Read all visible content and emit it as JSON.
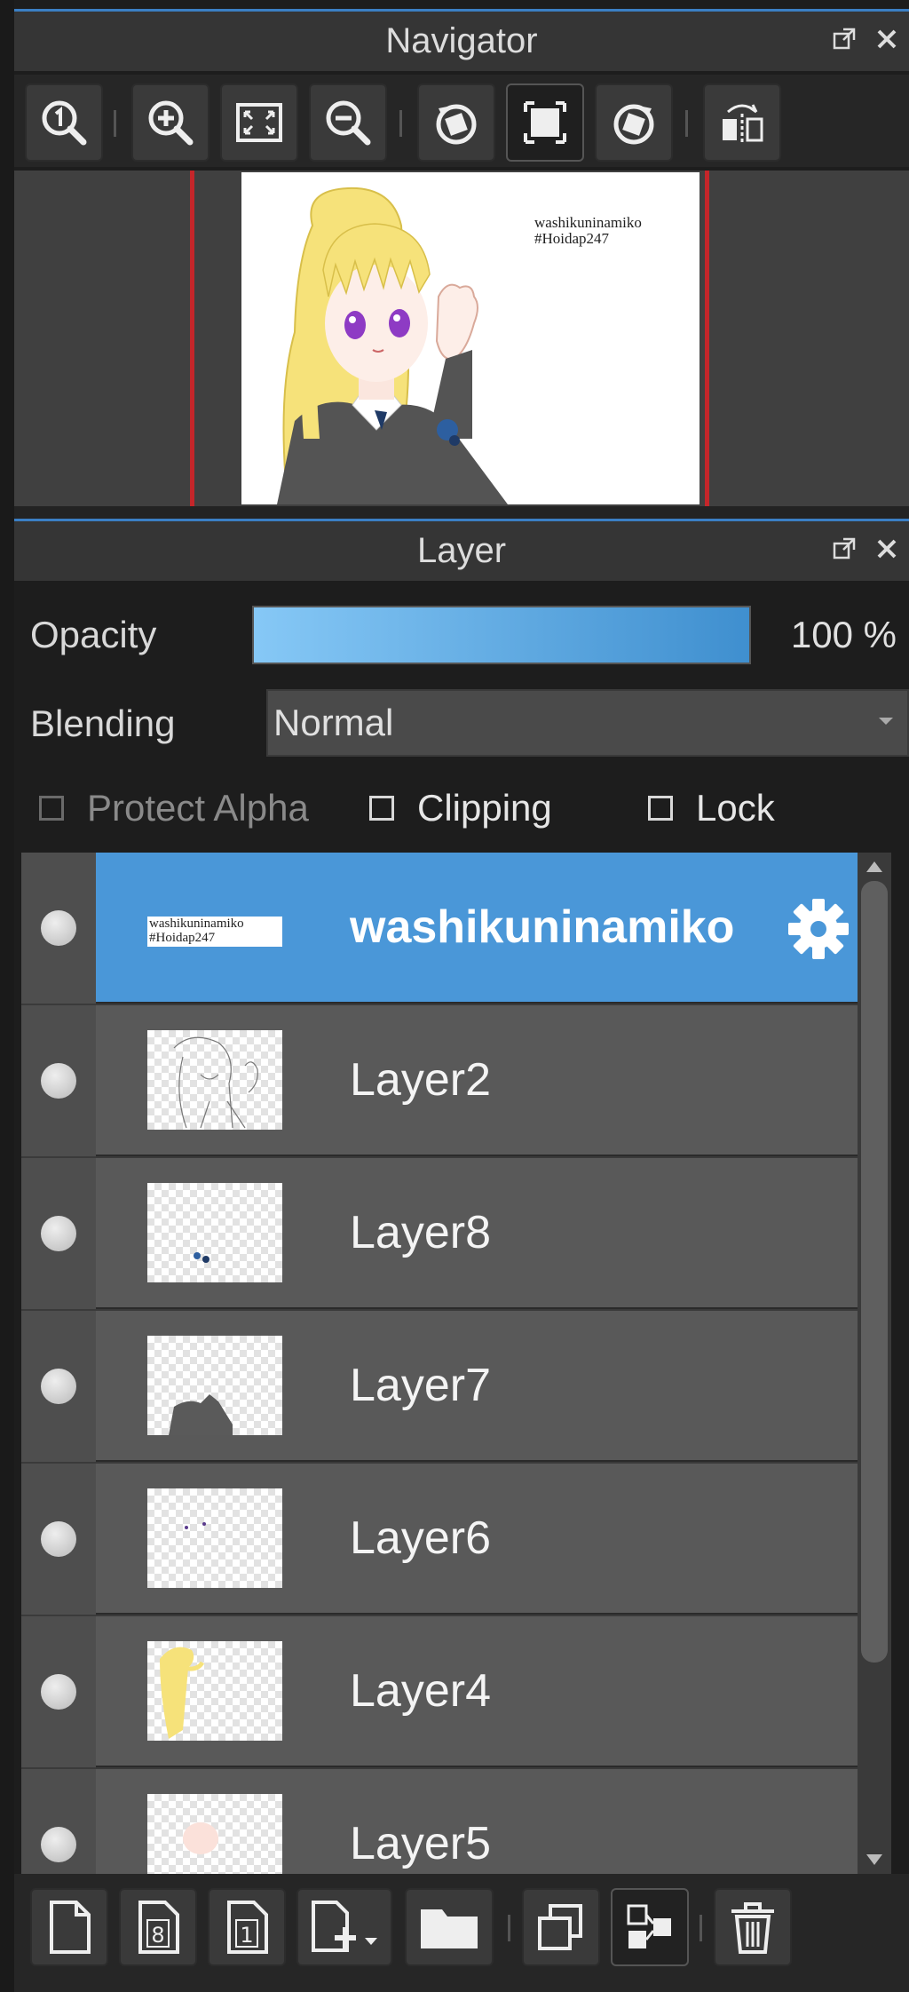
{
  "navigator": {
    "title": "Navigator",
    "preview_text_line1": "washikuninamiko",
    "preview_text_line2": "#Hoidap247"
  },
  "layer_panel": {
    "title": "Layer",
    "opacity_label": "Opacity",
    "opacity_value": "100 %",
    "blending_label": "Blending",
    "blending_value": "Normal",
    "protect_alpha_label": "Protect Alpha",
    "clipping_label": "Clipping",
    "lock_label": "Lock",
    "layers": [
      {
        "name": "washikuninamiko",
        "selected": true,
        "thumb": "text"
      },
      {
        "name": "Layer2",
        "selected": false,
        "thumb": "sketch"
      },
      {
        "name": "Layer8",
        "selected": false,
        "thumb": "dots"
      },
      {
        "name": "Layer7",
        "selected": false,
        "thumb": "body"
      },
      {
        "name": "Layer6",
        "selected": false,
        "thumb": "tiny"
      },
      {
        "name": "Layer4",
        "selected": false,
        "thumb": "hair"
      },
      {
        "name": "Layer5",
        "selected": false,
        "thumb": "skin"
      }
    ],
    "thumb_text_line1": "washikuninamiko",
    "thumb_text_line2": "#Hoidap247"
  },
  "colors": {
    "accent": "#4a97d8",
    "selection_row": "#4a97d8",
    "opacity_gradient_start": "#86c8f6",
    "opacity_gradient_end": "#3f8fcf",
    "canvas_border": "#c4262a"
  }
}
